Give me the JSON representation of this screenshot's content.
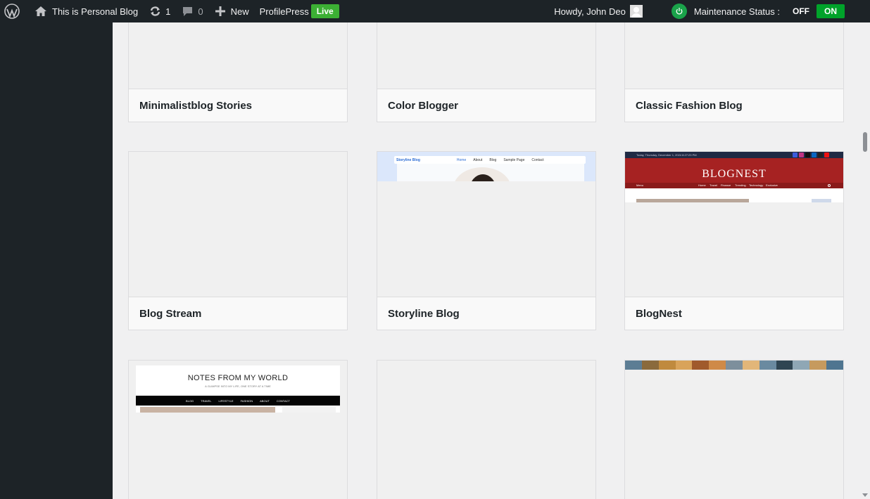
{
  "adminbar": {
    "site_name": "This is Personal Blog",
    "updates_count": "1",
    "comments_count": "0",
    "new_label": "New",
    "profilepress_label": "ProfilePress",
    "live_label": "Live",
    "howdy": "Howdy, John Deo",
    "maintenance_label": "Maintenance Status :",
    "toggle_off": "OFF",
    "toggle_on": "ON"
  },
  "templates": [
    {
      "name": "Minimalistblog Stories"
    },
    {
      "name": "Color Blogger"
    },
    {
      "name": "Classic Fashion Blog"
    },
    {
      "name": "Blog Stream"
    },
    {
      "name": "Storyline Blog"
    },
    {
      "name": "BlogNest"
    }
  ],
  "previews": {
    "storyline": {
      "brand": "Storyline Blog",
      "menu": [
        "Home",
        "About",
        "Blog",
        "Sample Page",
        "Contact"
      ]
    },
    "blognest": {
      "date": "Today, Thursday, December 1, 2024   8:27:23 PM",
      "logo": "BLOGNEST",
      "menu": [
        "Menu",
        "Home",
        "Travel",
        "Finance",
        "Trending",
        "Technology",
        "Exclusive"
      ]
    },
    "notes": {
      "title": "NOTES FROM MY WORLD",
      "subtitle": "A GLIMPSE INTO MY LIFE, ONE STORY AT A TIME",
      "menu": [
        "BLOG",
        "TRAVEL",
        "LIFESTYLE",
        "FASHION",
        "ABOUT",
        "CONTACT"
      ]
    }
  },
  "colors": {
    "adminbar_bg": "#1d2327",
    "live_badge": "#3cb034",
    "toggle_on": "#00a32a",
    "content_bg": "#f0f0f1"
  }
}
